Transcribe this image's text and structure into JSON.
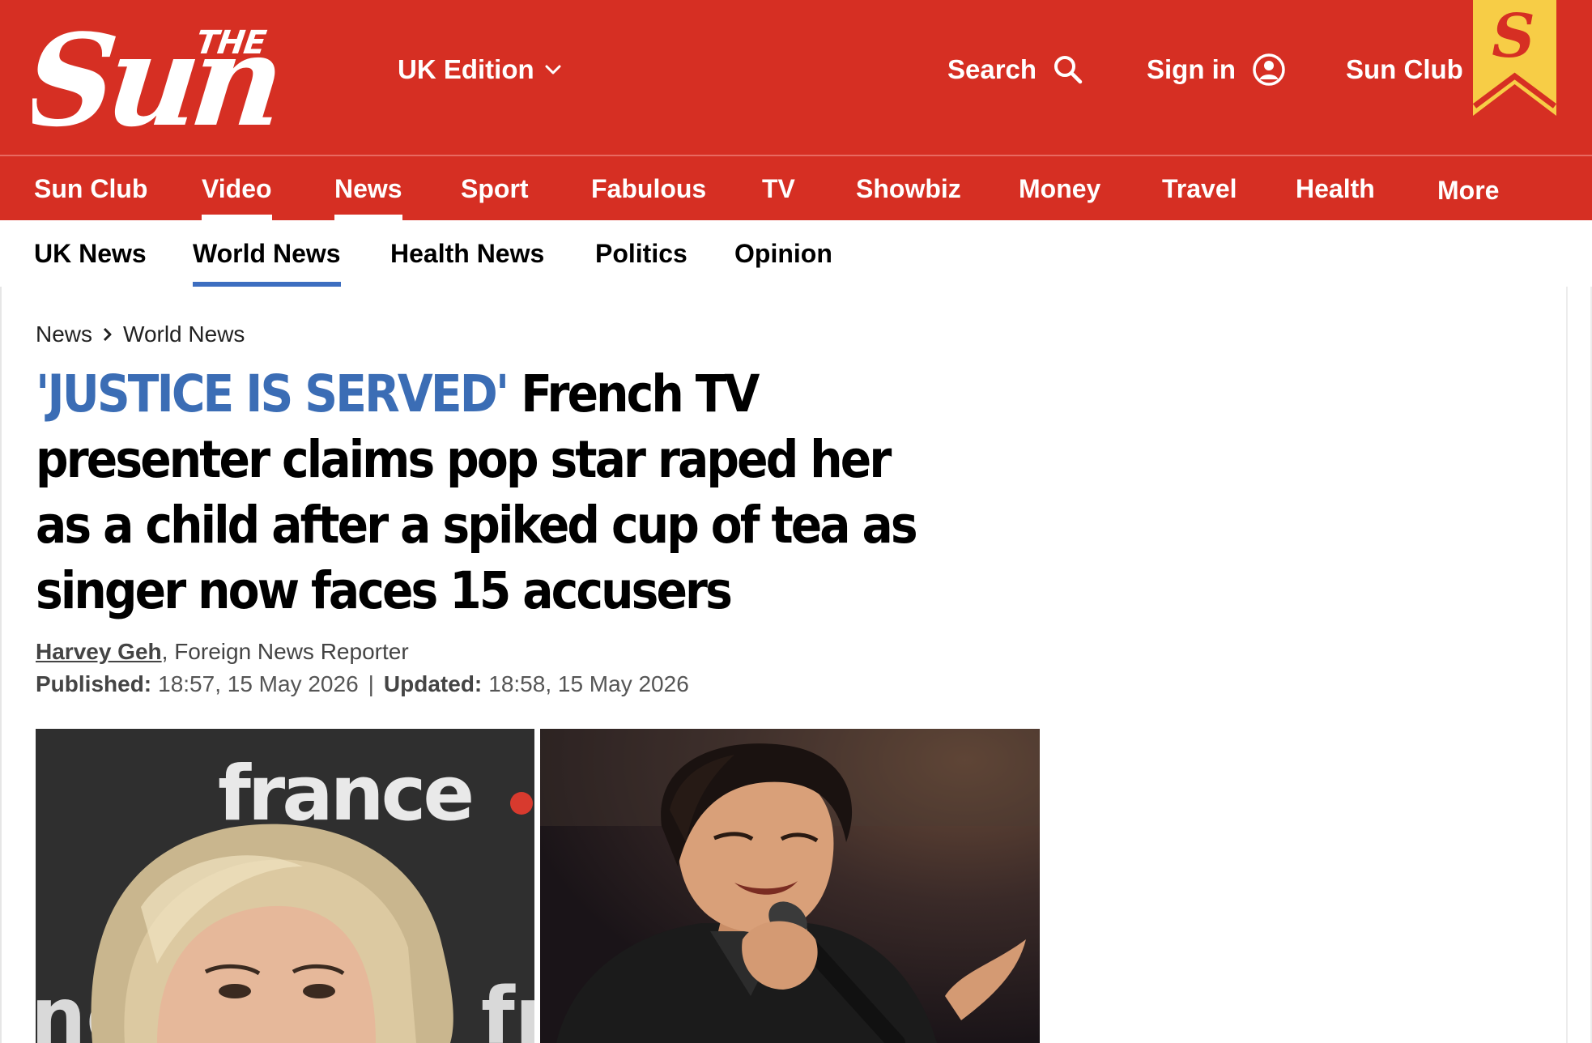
{
  "header": {
    "logo_small": "THE",
    "logo_main": "Sun",
    "edition_label": "UK Edition",
    "search_label": "Search",
    "signin_label": "Sign in",
    "sun_club_label": "Sun Club",
    "ribbon_letter": "S"
  },
  "primary_nav": {
    "items": [
      {
        "label": "Sun Club"
      },
      {
        "label": "Video",
        "active": true
      },
      {
        "label": "News",
        "active": true
      },
      {
        "label": "Sport"
      },
      {
        "label": "Fabulous"
      },
      {
        "label": "TV"
      },
      {
        "label": "Showbiz"
      },
      {
        "label": "Money"
      },
      {
        "label": "Travel"
      },
      {
        "label": "Health"
      },
      {
        "label": "More"
      }
    ]
  },
  "secondary_nav": {
    "items": [
      {
        "label": "UK News"
      },
      {
        "label": "World News",
        "active": true
      },
      {
        "label": "Health News"
      },
      {
        "label": "Politics"
      },
      {
        "label": "Opinion"
      }
    ]
  },
  "breadcrumb": {
    "items": [
      "News",
      "World News"
    ]
  },
  "article": {
    "kicker": "'JUSTICE IS SERVED'",
    "headline": "French TV presenter claims pop star raped her as a child after a spiked cup of tea as singer now faces 15 accusers",
    "author": "Harvey Geh",
    "author_role": ", Foreign News Reporter",
    "published_label": "Published:",
    "published_value": "18:57, 15 May 2026",
    "date_separator": "|",
    "updated_label": "Updated:",
    "updated_value": "18:58, 15 May 2026",
    "image_left_caption_text": "france",
    "image_left_partial_text_1": "nc",
    "image_left_partial_text_2": "fr"
  },
  "colors": {
    "brand_red": "#d62f23",
    "kicker_blue": "#3b6db5",
    "ribbon_yellow": "#f7cd46",
    "active_underline": "#3d6ec0"
  }
}
